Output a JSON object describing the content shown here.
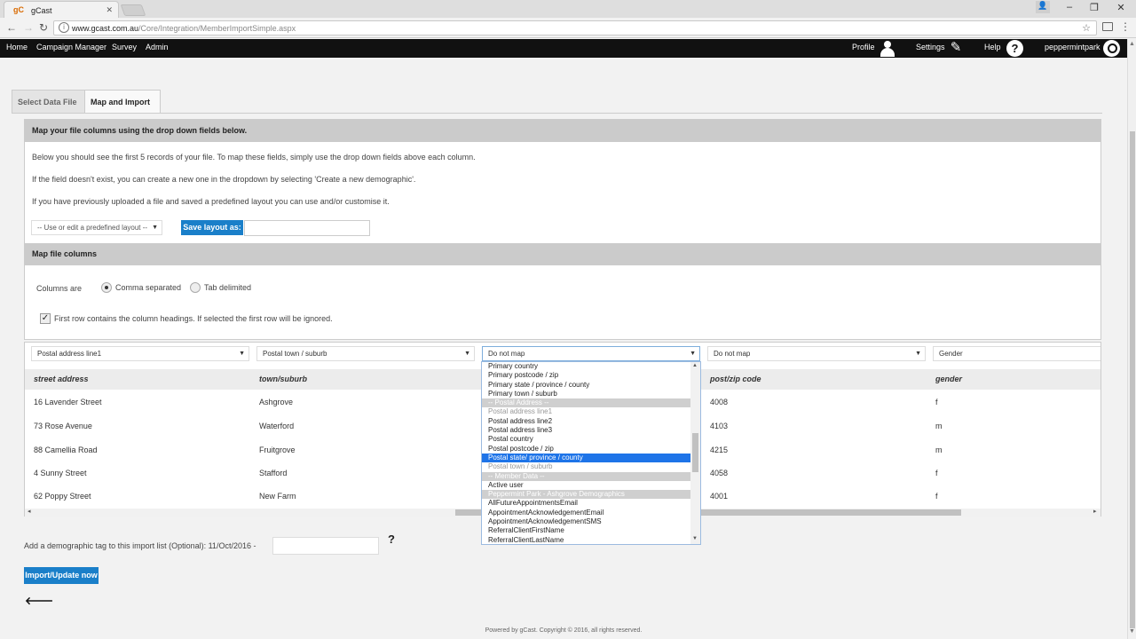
{
  "browser": {
    "tab_title": "gCast",
    "tab_favicon": "gC",
    "url_host": "www.gcast.com.au",
    "url_path": "/Core/Integration/MemberImportSimple.aspx"
  },
  "nav": {
    "left": [
      "Home",
      "Campaign Manager",
      "Survey",
      "Admin"
    ],
    "profile": "Profile",
    "settings": "Settings",
    "help": "Help",
    "user": "peppermintpark"
  },
  "tabs": [
    "Select Data File",
    "Map and Import"
  ],
  "panel": {
    "heading": "Map your file columns using the drop down fields below.",
    "line1": "Below you should see the first 5 records of your file. To map these fields, simply use the drop down fields above each column.",
    "line2": "If the field doesn't exist, you can create a new one in the dropdown by selecting 'Create a new demographic'.",
    "line3": "If you have previously uploaded a file and saved a predefined layout you can use and/or customise it.",
    "layout_select": "-- Use or edit a predefined layout --",
    "save_label": "Save layout as:",
    "map_heading": "Map file columns",
    "columns_are": "Columns are",
    "comma": "Comma separated",
    "tab": "Tab delimited",
    "first_row": "First row contains the column headings. If selected the first row will be ignored."
  },
  "columns": [
    {
      "select": "Postal address line1",
      "header": "street address",
      "cells": [
        "16 Lavender Street",
        "73 Rose Avenue",
        "88 Camellia Road",
        "4 Sunny Street",
        "62 Poppy Street"
      ]
    },
    {
      "select": "Postal town / suburb",
      "header": "town/suburb",
      "cells": [
        "Ashgrove",
        "Waterford",
        "Fruitgrove",
        "Stafford",
        "New Farm"
      ]
    },
    {
      "select": "Do not map",
      "header": "",
      "cells": [
        "",
        "",
        "",
        "",
        ""
      ]
    },
    {
      "select": "Do not map",
      "header": "post/zip code",
      "cells": [
        "4008",
        "4103",
        "4215",
        "4058",
        "4001"
      ]
    },
    {
      "select": "Gender",
      "header": "gender",
      "cells": [
        "f",
        "m",
        "m",
        "f",
        "f"
      ]
    }
  ],
  "dropdown": [
    {
      "label": "Primary country",
      "kind": "normal"
    },
    {
      "label": "Primary postcode / zip",
      "kind": "normal"
    },
    {
      "label": "Primary state / province / county",
      "kind": "normal"
    },
    {
      "label": "Primary town / suburb",
      "kind": "normal"
    },
    {
      "label": "-- Postal Address --",
      "kind": "group"
    },
    {
      "label": "Postal address line1",
      "kind": "disabled"
    },
    {
      "label": "Postal address line2",
      "kind": "normal"
    },
    {
      "label": "Postal address line3",
      "kind": "normal"
    },
    {
      "label": "Postal country",
      "kind": "normal"
    },
    {
      "label": "Postal postcode / zip",
      "kind": "normal"
    },
    {
      "label": "Postal state/ province / county",
      "kind": "selected"
    },
    {
      "label": "Postal town / suburb",
      "kind": "disabled"
    },
    {
      "label": "-- Member Data --",
      "kind": "group"
    },
    {
      "label": "Active user",
      "kind": "normal"
    },
    {
      "label": "Peppermint Park - Ashgrove Demographics",
      "kind": "group"
    },
    {
      "label": "AllFutureAppointmentsEmail",
      "kind": "normal"
    },
    {
      "label": "AppointmentAcknowledgementEmail",
      "kind": "normal"
    },
    {
      "label": "AppointmentAcknowledgementSMS",
      "kind": "normal"
    },
    {
      "label": "ReferralClientFirstName",
      "kind": "normal"
    },
    {
      "label": "ReferralClientLastName",
      "kind": "normal"
    }
  ],
  "tag_label": "Add a demographic tag to this import list (Optional): 11/Oct/2016 -",
  "help_mark": "?",
  "import_label": "Import/Update now",
  "footer": "Powered by gCast. Copyright © 2016, all rights reserved."
}
